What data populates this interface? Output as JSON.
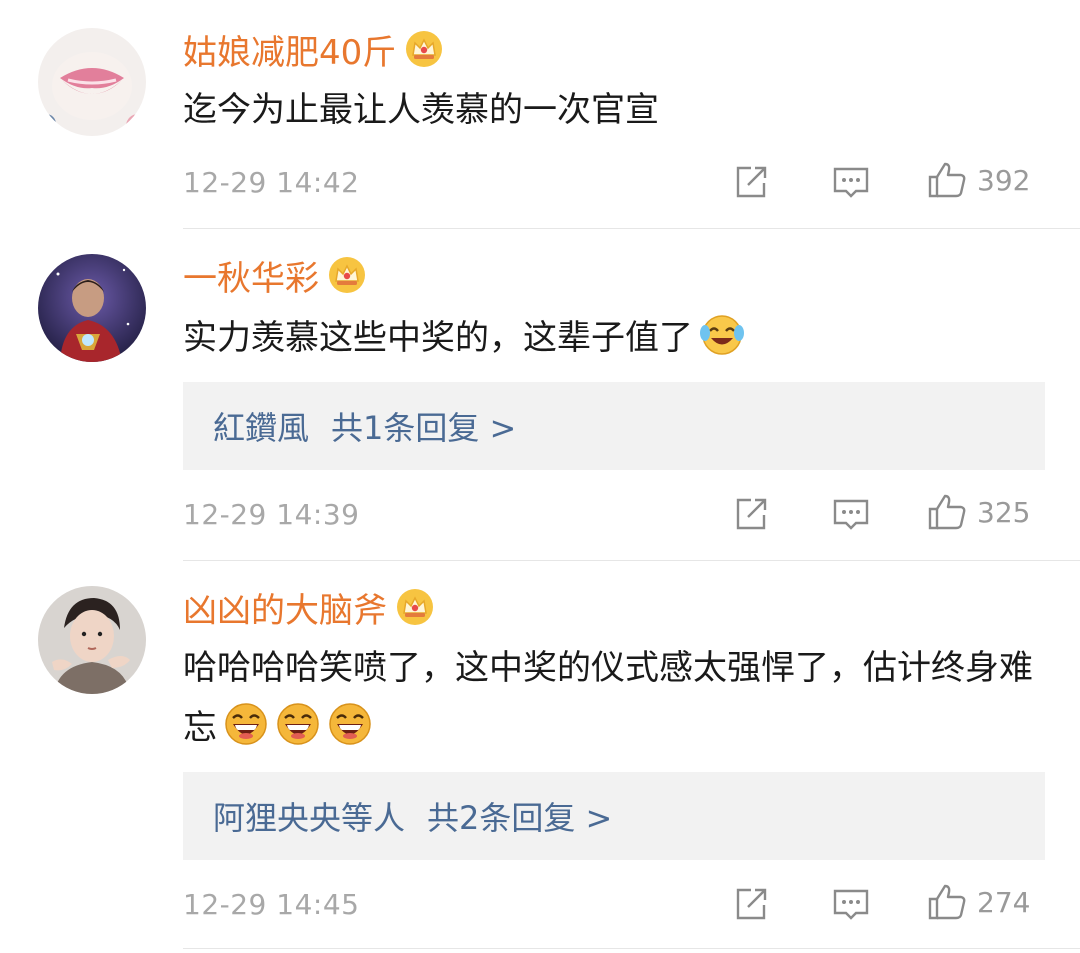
{
  "comments": [
    {
      "username": "姑娘减肥40斤",
      "text": "迄今为止最让人羡慕的一次官宣",
      "time": "12-29 14:42",
      "likes": "392"
    },
    {
      "username": "一秋华彩",
      "text": "实力羡慕这些中奖的，这辈子值了",
      "reply_users": "紅鑽風",
      "reply_count": "共1条回复 >",
      "time": "12-29 14:39",
      "likes": "325"
    },
    {
      "username": "凶凶的大脑斧",
      "text": "哈哈哈哈笑喷了，这中奖的仪式感太强悍了，估计终身难忘",
      "reply_users": "阿狸央央等人",
      "reply_count": "共2条回复 >",
      "time": "12-29 14:45",
      "likes": "274"
    }
  ],
  "icons": {
    "vip_badge": "crown-badge-icon",
    "share": "share-icon",
    "comment": "comment-icon",
    "like": "thumbs-up-icon",
    "laugh_cry": "laughing-tears-emoji",
    "laugh": "laughing-emoji"
  },
  "colors": {
    "username": "#e8772e",
    "reply_link": "#4a6a94",
    "meta": "#a8a8a8",
    "reply_bg": "#f2f2f2"
  }
}
